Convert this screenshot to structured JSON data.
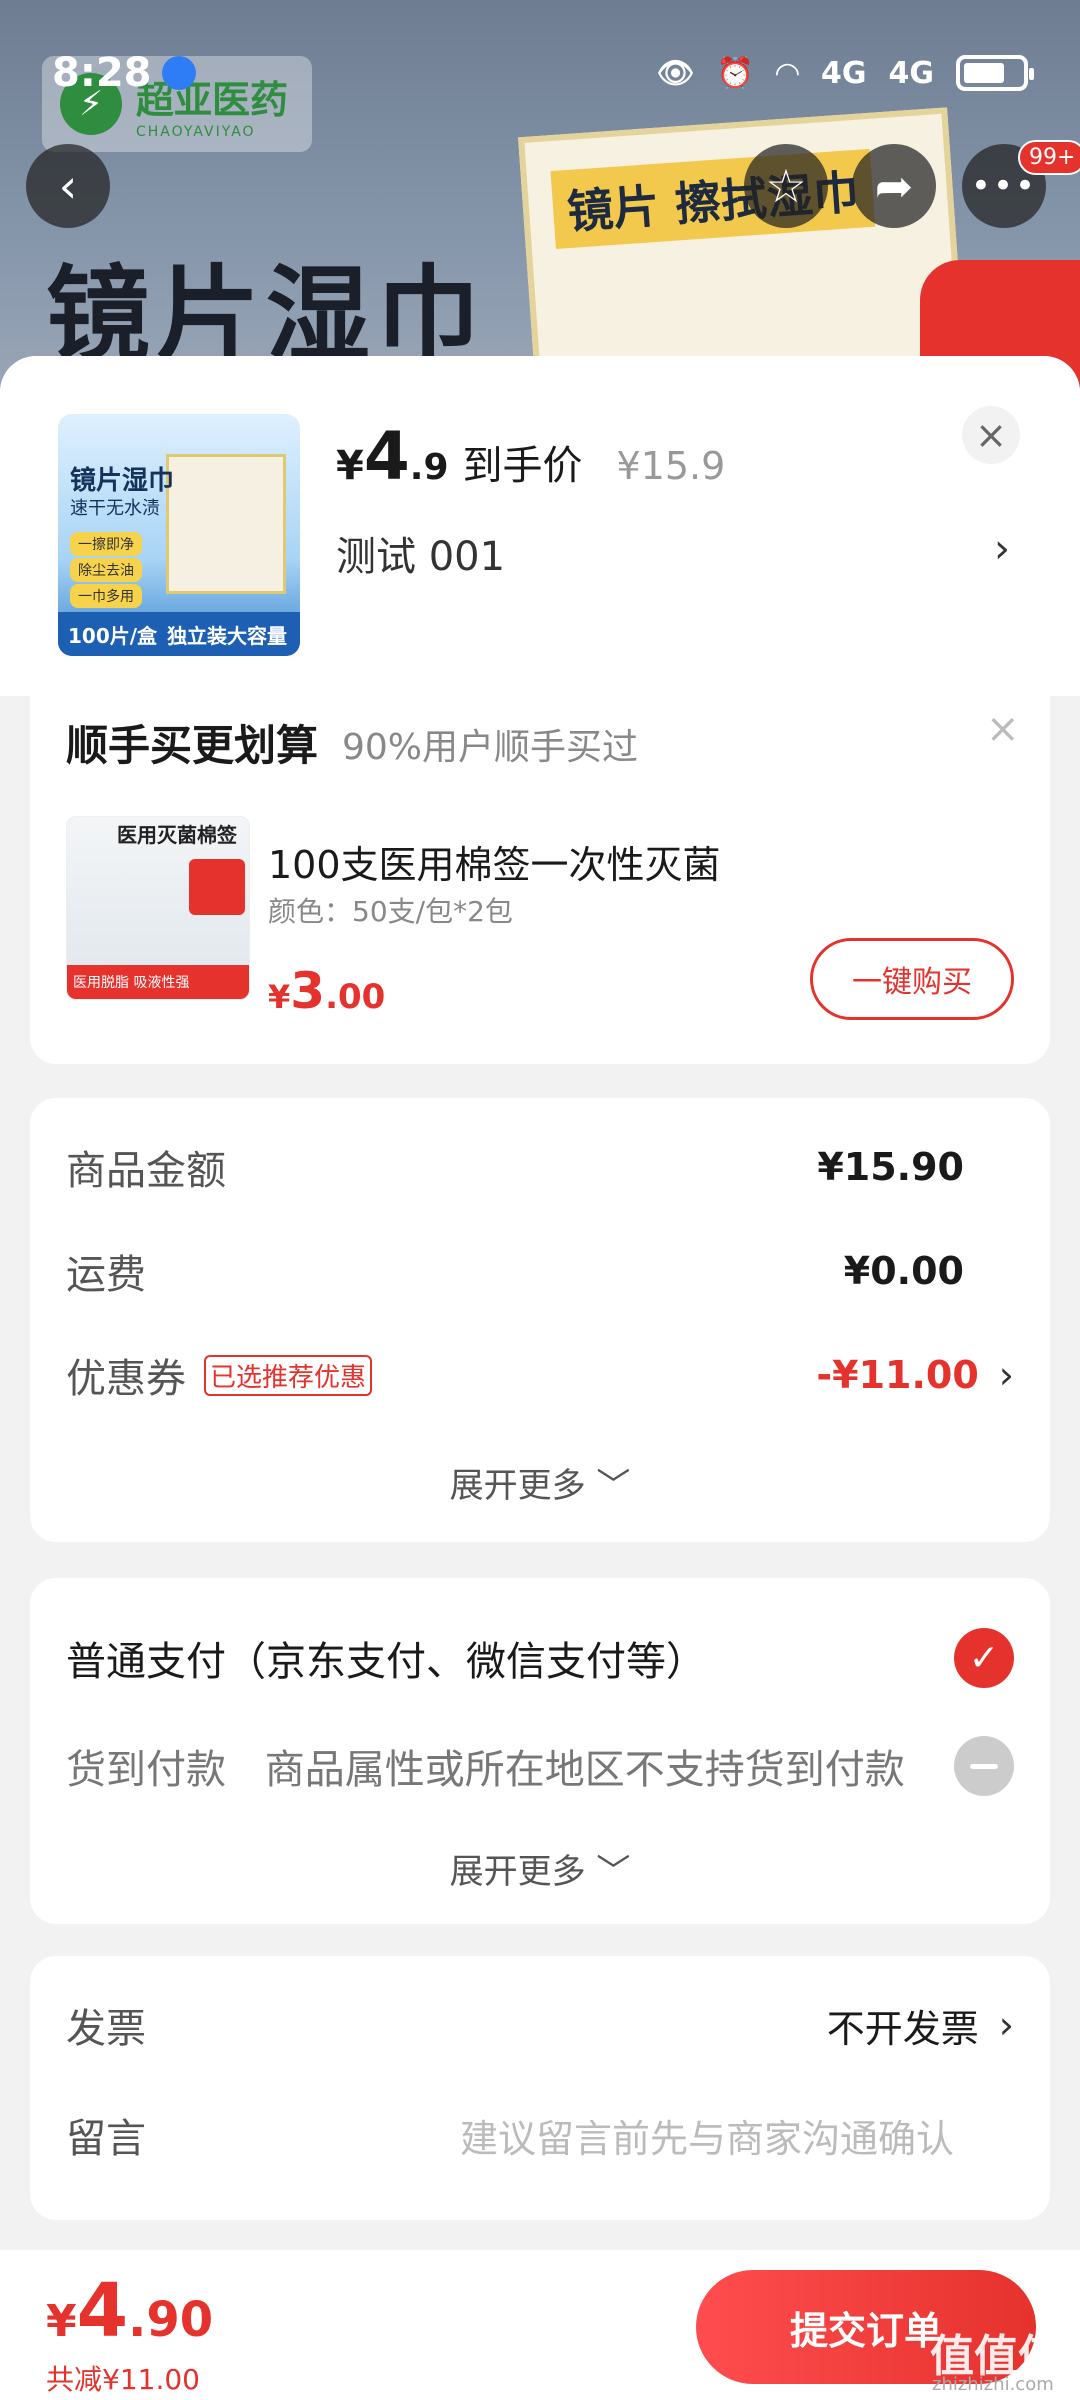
{
  "status_bar": {
    "time": "8:28",
    "network1": "4G",
    "network2": "4G"
  },
  "background": {
    "brand_cn": "超亚医药",
    "brand_en": "CHAOYAVIYAO",
    "title": "镜片湿巾",
    "box_label": "镜片 擦拭湿巾",
    "notification_count": "99+"
  },
  "product": {
    "thumb_title": "镜片湿巾",
    "thumb_sub": "速干无水渍",
    "thumb_tags": [
      "一擦即净",
      "除尘去油",
      "一巾多用"
    ],
    "thumb_count": "100片/盒",
    "thumb_bar": "独立装大容量",
    "price_symbol": "¥",
    "price_int": "4",
    "price_dec": ".9",
    "price_label": "到手价",
    "orig_price": "¥15.9",
    "spec": "测试  001"
  },
  "upsell": {
    "title": "顺手买更划算",
    "subtitle": "90%用户顺手买过",
    "thumb_title": "医用灭菌棉签",
    "thumb_footer": "医用脱脂 吸液性强",
    "name": "100支医用棉签一次性灭菌",
    "spec": "颜色：50支/包*2包",
    "price_symbol": "¥",
    "price_int": "3",
    "price_dec": ".00",
    "buy_label": "一键购买"
  },
  "amounts": {
    "goods_label": "商品金额",
    "goods_value": "¥15.90",
    "shipping_label": "运费",
    "shipping_value": "¥0.00",
    "coupon_label": "优惠券",
    "coupon_tag": "已选推荐优惠",
    "coupon_value": "-¥11.00",
    "expand_label": "展开更多 ﹀"
  },
  "payment": {
    "normal_label": "普通支付（京东支付、微信支付等）",
    "cod_label": "货到付款",
    "cod_note": "商品属性或所在地区不支持货到付款",
    "expand_label": "展开更多 ﹀"
  },
  "extra": {
    "invoice_label": "发票",
    "invoice_value": "不开发票",
    "message_label": "留言",
    "message_placeholder": "建议留言前先与商家沟通确认"
  },
  "footer": {
    "total_symbol": "¥",
    "total_int": "4",
    "total_dec": ".90",
    "saved": "共减¥11.00",
    "submit_label": "提交订单",
    "watermark": "值值值",
    "watermark_url": "zhizhizhi.com"
  },
  "colors": {
    "accent": "#e5322d",
    "bg": "#f2f2f2"
  }
}
